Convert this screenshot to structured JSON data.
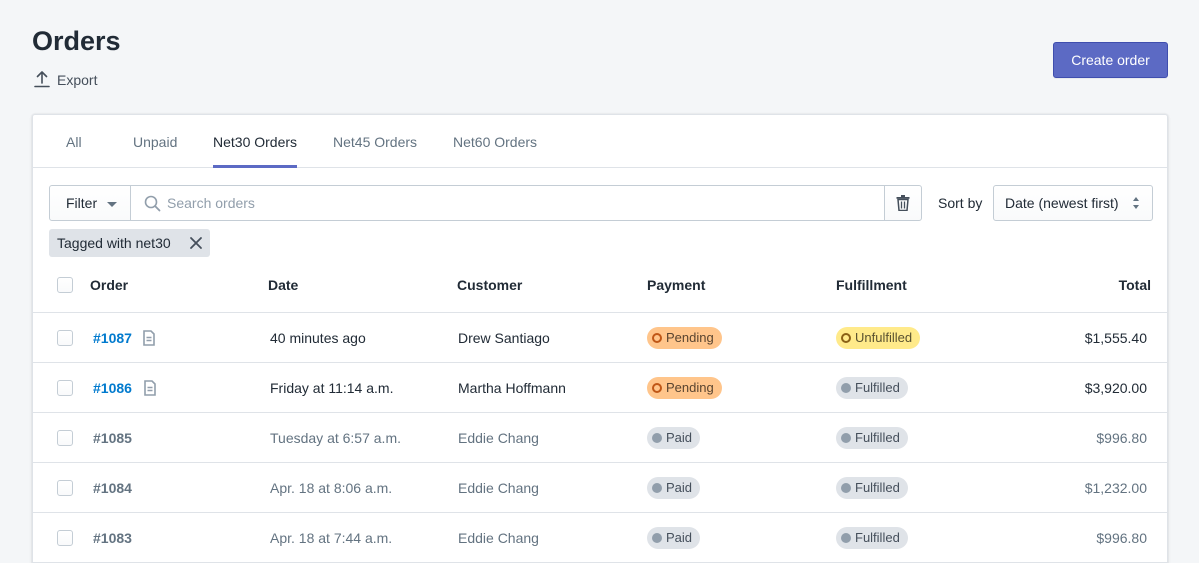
{
  "header": {
    "title": "Orders",
    "export_label": "Export",
    "create_label": "Create order"
  },
  "tabs": [
    {
      "label": "All",
      "active": false
    },
    {
      "label": "Unpaid",
      "active": false
    },
    {
      "label": "Net30 Orders",
      "active": true
    },
    {
      "label": "Net45 Orders",
      "active": false
    },
    {
      "label": "Net60 Orders",
      "active": false
    }
  ],
  "filters": {
    "filter_label": "Filter",
    "search_placeholder": "Search orders",
    "sort_label": "Sort by",
    "sort_value": "Date (newest first)",
    "active_tag": "Tagged with net30"
  },
  "table": {
    "columns": {
      "order": "Order",
      "date": "Date",
      "customer": "Customer",
      "payment": "Payment",
      "fulfillment": "Fulfillment",
      "total": "Total"
    },
    "rows": [
      {
        "order": "#1087",
        "date": "40 minutes ago",
        "customer": "Drew Santiago",
        "payment": "Pending",
        "fulfillment": "Unfulfilled",
        "total": "$1,555.40",
        "unread": true,
        "has_note": true
      },
      {
        "order": "#1086",
        "date": "Friday at 11:14 a.m.",
        "customer": "Martha Hoffmann",
        "payment": "Pending",
        "fulfillment": "Fulfilled",
        "total": "$3,920.00",
        "unread": true,
        "has_note": true
      },
      {
        "order": "#1085",
        "date": "Tuesday at 6:57 a.m.",
        "customer": "Eddie Chang",
        "payment": "Paid",
        "fulfillment": "Fulfilled",
        "total": "$996.80",
        "unread": false,
        "has_note": false
      },
      {
        "order": "#1084",
        "date": "Apr. 18 at 8:06 a.m.",
        "customer": "Eddie Chang",
        "payment": "Paid",
        "fulfillment": "Fulfilled",
        "total": "$1,232.00",
        "unread": false,
        "has_note": false
      },
      {
        "order": "#1083",
        "date": "Apr. 18 at 7:44 a.m.",
        "customer": "Eddie Chang",
        "payment": "Paid",
        "fulfillment": "Fulfilled",
        "total": "$996.80",
        "unread": false,
        "has_note": false
      }
    ]
  },
  "colors": {
    "primary": "#5c6ac4",
    "link": "#007ace",
    "pending_badge": "#ffc58b",
    "unfulfilled_badge": "#ffea8a",
    "neutral_badge": "#dfe3e8"
  }
}
